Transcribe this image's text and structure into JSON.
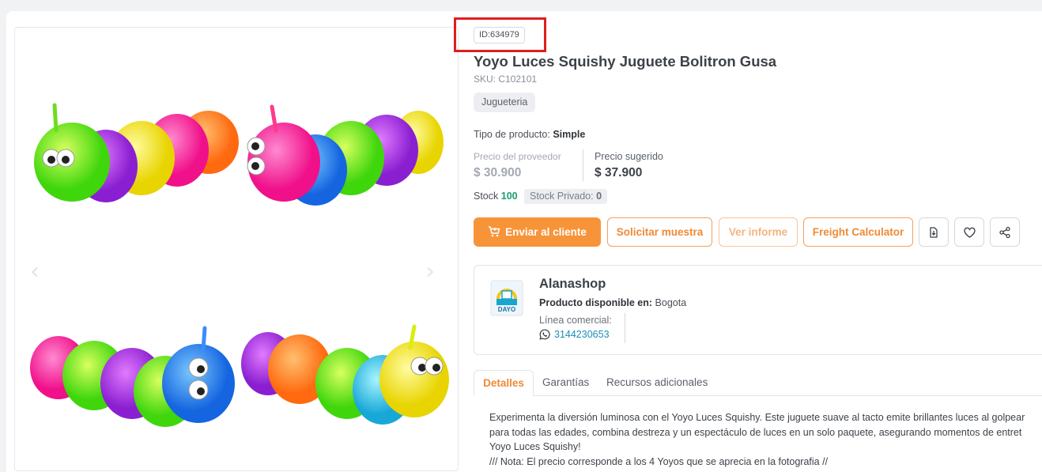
{
  "product": {
    "id_label": "ID:634979",
    "title": "Yoyo Luces Squishy Juguete Bolitron Gusa",
    "sku": "SKU: C102101",
    "category": "Jugueteria",
    "type_label": "Tipo de producto:",
    "type_value": "Simple",
    "supplier_price_label": "Precio del proveedor",
    "supplier_price": "$ 30.900",
    "suggested_price_label": "Precio sugerido",
    "suggested_price": "$ 37.900",
    "stock_label": "Stock",
    "stock_value": "100",
    "private_stock_label": "Stock Privado:",
    "private_stock_value": "0"
  },
  "actions": {
    "send_client": "Enviar al cliente",
    "request_sample": "Solicitar muestra",
    "view_report": "Ver informe",
    "freight_calculator": "Freight Calculator"
  },
  "seller": {
    "name": "Alanashop",
    "availability_label": "Producto disponible en:",
    "availability_value": "Bogota",
    "commercial_line_label": "Línea comercial:",
    "phone": "3144230653",
    "logo_text": "DAYO"
  },
  "tabs": {
    "details": "Detalles",
    "warranties": "Garantías",
    "resources": "Recursos adicionales"
  },
  "description": {
    "line1": "Experimenta la diversión luminosa con el Yoyo Luces Squishy. Este juguete suave al tacto emite brillantes luces al golpear",
    "line2": "para todas las edades, combina destreza y un espectáculo de luces en un solo paquete, asegurando momentos de entret",
    "line3": "Yoyo Luces Squishy!",
    "line4": "/// Nota: El precio corresponde a los 4 Yoyos que se aprecia en la fotografia //"
  },
  "colors": {
    "accent": "#f7943a",
    "highlight_box": "#e01e1e",
    "stock_green": "#1aa06d",
    "phone_link": "#1a8fb5"
  },
  "icons": [
    "cart-icon",
    "download-icon",
    "heart-icon",
    "share-icon",
    "whatsapp-icon",
    "chevron-left-icon",
    "chevron-right-icon"
  ]
}
